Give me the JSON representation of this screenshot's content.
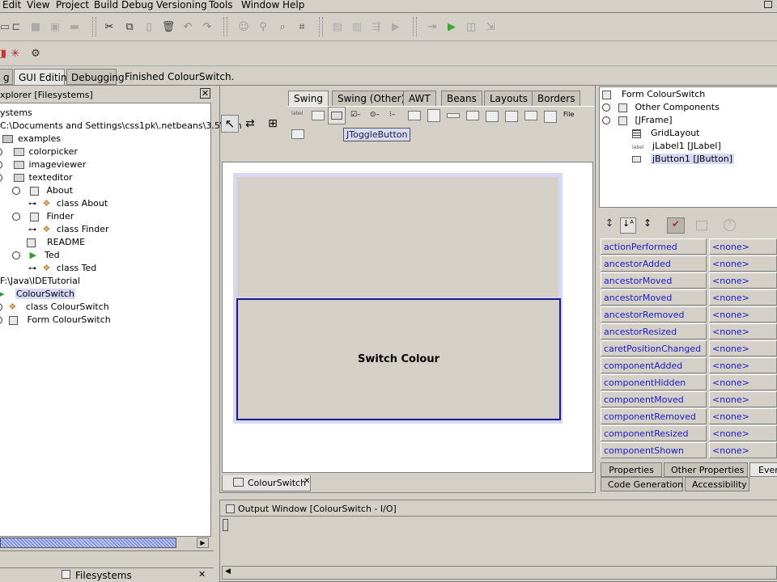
{
  "menubar": [
    "Edit",
    "View",
    "Project",
    "Build",
    "Debug",
    "Versioning",
    "Tools",
    "Window",
    "Help"
  ],
  "workspace_tabs": {
    "partial_left": "g",
    "gui_editing": "GUI Editing",
    "debugging": "Debugging",
    "status": "Finished ColourSwitch."
  },
  "explorer": {
    "title": "xplorer [Filesystems]",
    "root": "ystems",
    "path": "C:\\Documents and Settings\\css1pk\\.netbeans\\3.5\\sam",
    "items": [
      "examples",
      "colorpicker",
      "imageviewer",
      "texteditor",
      "About",
      "class About",
      "Finder",
      "class Finder",
      "README",
      "Ted",
      "class Ted"
    ],
    "tutorial_path": "F:\\Java\\IDETutorial",
    "tutorial_items": [
      "ColourSwitch",
      "class ColourSwitch",
      "Form ColourSwitch"
    ],
    "bottom_tab": "Filesystems"
  },
  "palette": {
    "tabs": [
      "Swing",
      "Swing (Other)",
      "AWT",
      "Beans",
      "Layouts",
      "Borders"
    ],
    "tooltip": "JToggleButton"
  },
  "form": {
    "button_label": "Switch Colour",
    "doc_tab": "ColourSwitch"
  },
  "inspector": {
    "items": [
      "Form ColourSwitch",
      "Other Components",
      "[JFrame]",
      "GridLayout",
      "jLabel1 [JLabel]",
      "jButton1 [JButton]"
    ]
  },
  "properties": {
    "rows": [
      {
        "name": "actionPerformed",
        "value": "<none>"
      },
      {
        "name": "ancestorAdded",
        "value": "<none>"
      },
      {
        "name": "ancestorMoved",
        "value": "<none>"
      },
      {
        "name": "ancestorMoved",
        "value": "<none>"
      },
      {
        "name": "ancestorRemoved",
        "value": "<none>"
      },
      {
        "name": "ancestorResized",
        "value": "<none>"
      },
      {
        "name": "caretPositionChanged",
        "value": "<none>"
      },
      {
        "name": "componentAdded",
        "value": "<none>"
      },
      {
        "name": "componentHidden",
        "value": "<none>"
      },
      {
        "name": "componentMoved",
        "value": "<none>"
      },
      {
        "name": "componentRemoved",
        "value": "<none>"
      },
      {
        "name": "componentResized",
        "value": "<none>"
      },
      {
        "name": "componentShown",
        "value": "<none>"
      }
    ],
    "tabs": [
      "Properties",
      "Other Properties",
      "Ever",
      "Code Generation",
      "Accessibility"
    ]
  },
  "output": {
    "title": "Output Window [ColourSwitch - I/O]"
  }
}
